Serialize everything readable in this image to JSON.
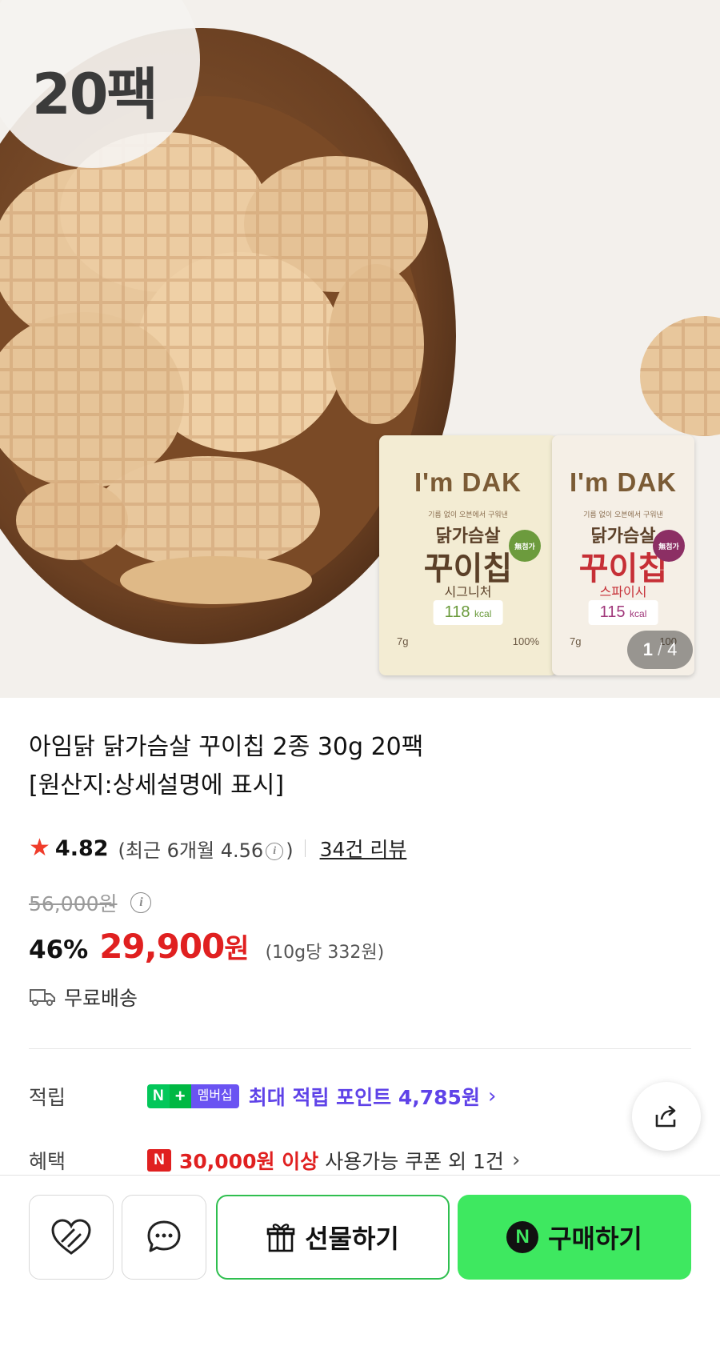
{
  "hero": {
    "pack_count_badge": "20팩",
    "slide_current": "1",
    "slide_total": "4",
    "packs": [
      {
        "brand": "I'm DAK",
        "tagline": "기름 없이 오븐에서 구워낸",
        "name_line1": "닭가슴살",
        "name_line2": "꾸이칩",
        "flavor": "시그니처",
        "kcal": "118",
        "kcal_unit": "kcal",
        "fact_protein": "7g",
        "fact_percent": "100%",
        "badge": "無첨가"
      },
      {
        "brand": "I'm DAK",
        "tagline": "기름 없이 오븐에서 구워낸",
        "name_line1": "닭가슴살",
        "name_line2": "꾸이칩",
        "flavor": "스파이시",
        "kcal": "115",
        "kcal_unit": "kcal",
        "fact_protein": "7g",
        "fact_percent": "100",
        "badge": "無첨가"
      }
    ]
  },
  "product": {
    "title_line1": "아임닭 닭가슴살 꾸이칩 2종 30g 20팩",
    "title_line2": "[원산지:상세설명에 표시]",
    "rating": "4.82",
    "recent_prefix": "(최근 6개월 4.56",
    "recent_suffix": ")",
    "review_link": "34건 리뷰",
    "original_price": "56,000원",
    "discount": "46%",
    "price": "29,900",
    "price_unit": "원",
    "unit_price": "(10g당 332원)",
    "shipping": "무료배송"
  },
  "benefits": {
    "points_label": "적립",
    "membership_n": "N",
    "membership_plus": "+",
    "membership_text": "멤버십",
    "points_text": "최대 적립 포인트 4,785원",
    "coupon_label": "혜택",
    "coupon_icon": "N",
    "coupon_highlight": "30,000원 이상",
    "coupon_rest": "사용가능 쿠폰 외 1건"
  },
  "bottom_bar": {
    "gift_label": "선물하기",
    "buy_n": "N",
    "buy_label": "구매하기"
  },
  "colors": {
    "price_red": "#e02020",
    "naver_green": "#3ee860",
    "membership_purple": "#5f43e8",
    "star": "#f03c2a"
  }
}
